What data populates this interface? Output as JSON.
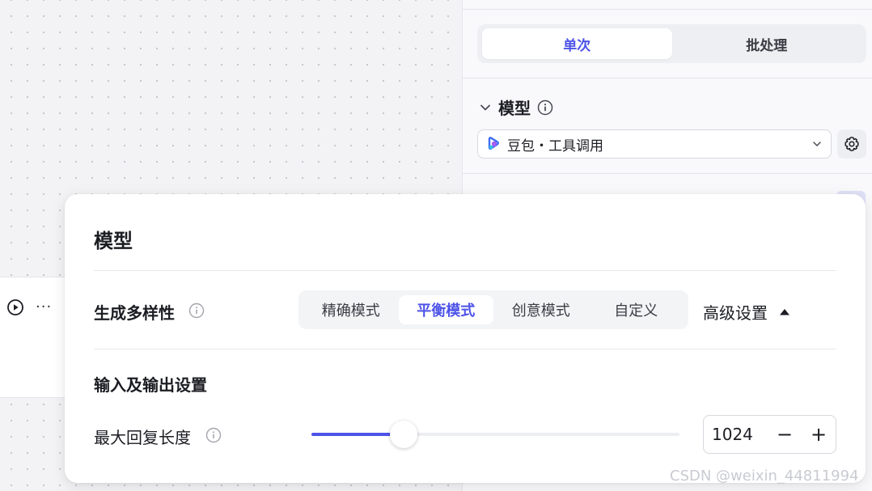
{
  "right_panel": {
    "tabs": [
      {
        "label": "单次",
        "active": true
      },
      {
        "label": "批处理",
        "active": false
      }
    ],
    "model_section": {
      "title": "模型",
      "selected_model": "豆包・工具调用"
    }
  },
  "popover": {
    "title": "模型",
    "diversity": {
      "label": "生成多样性",
      "modes": [
        "精确模式",
        "平衡模式",
        "创意模式",
        "自定义"
      ],
      "active_mode": "平衡模式",
      "advanced_label": "高级设置"
    },
    "io_settings": {
      "title": "输入及输出设置",
      "max_length": {
        "label": "最大回复长度",
        "value": "1024",
        "slider_fraction": 0.25,
        "minus": "−",
        "plus": "+"
      }
    }
  },
  "watermark": "CSDN @weixin_44811994",
  "colors": {
    "accent": "#4d53e8",
    "logo_blue": "#3b6cf6",
    "logo_purple": "#a45cf0"
  }
}
